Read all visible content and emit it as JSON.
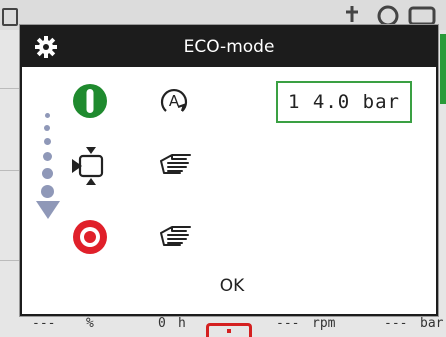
{
  "background": {
    "status_bar": [
      {
        "value": "---",
        "unit": "%"
      },
      {
        "value": "0",
        "unit": "h"
      },
      {
        "value": "---",
        "unit": "rpm"
      },
      {
        "value": "---",
        "unit": "bar"
      }
    ]
  },
  "dialog": {
    "title": "ECO-mode",
    "header_icon": "gear-icon",
    "rows": [
      {
        "state_icon": "power-on-icon",
        "mode_icon": "automatic-mode-icon",
        "state_color": "#1f8a2e"
      },
      {
        "state_icon": "valve-icon",
        "mode_icon": "manual-hand-icon"
      },
      {
        "state_icon": "power-off-icon",
        "mode_icon": "manual-hand-icon",
        "state_color": "#e0202a"
      }
    ],
    "pressure_value": "1 4.0 bar",
    "ok_label": "OK",
    "accent_color": "#3aa043",
    "dots_color": "#8f98b8"
  }
}
